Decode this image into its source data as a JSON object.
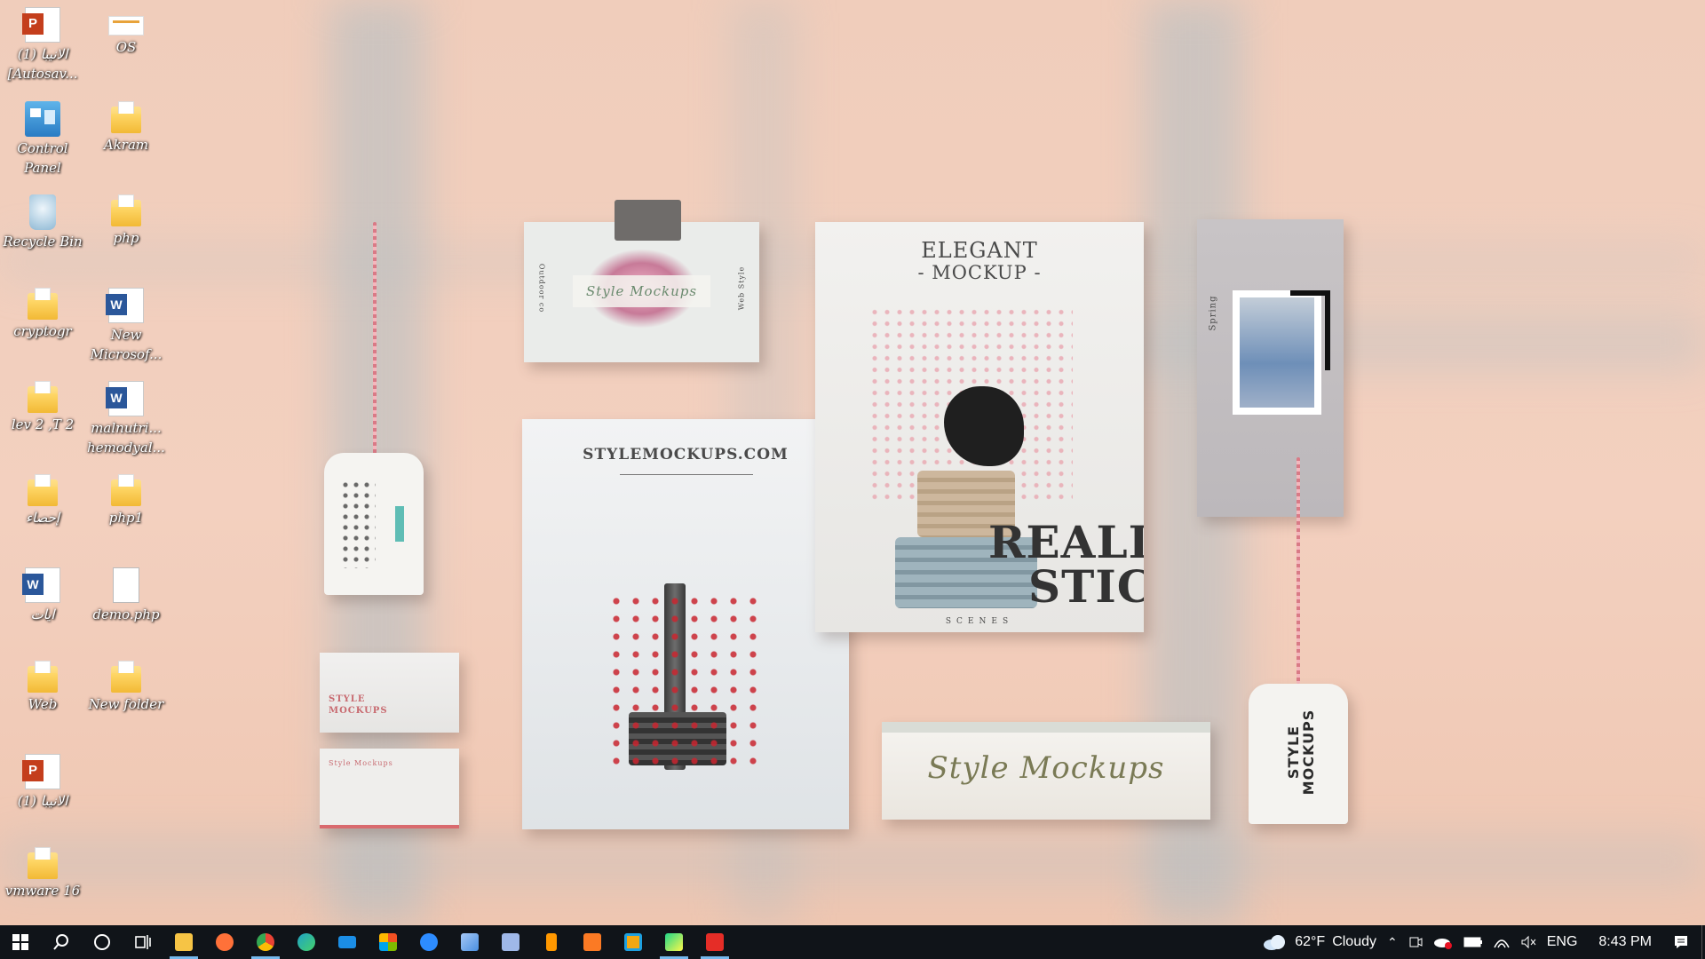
{
  "desktop": {
    "icons": [
      {
        "label": "(1) الانيبا [Autosav...",
        "icon": "powerpoint-icon"
      },
      {
        "label": "OS",
        "icon": "document-icon"
      },
      {
        "label": "Control Panel",
        "icon": "control-panel-icon"
      },
      {
        "label": "Akram",
        "icon": "folder-icon"
      },
      {
        "label": "Recycle Bin",
        "icon": "recycle-bin-icon"
      },
      {
        "label": "php",
        "icon": "folder-icon"
      },
      {
        "label": "cryptogr",
        "icon": "folder-icon"
      },
      {
        "label": "New Microsof...",
        "icon": "word-icon"
      },
      {
        "label": "lev 2 ,T 2",
        "icon": "folder-icon"
      },
      {
        "label": "malnutri... hemodyal...",
        "icon": "word-icon"
      },
      {
        "label": "إحصاء",
        "icon": "folder-icon"
      },
      {
        "label": "php1",
        "icon": "folder-icon"
      },
      {
        "label": "ايات",
        "icon": "word-icon"
      },
      {
        "label": "demo.php",
        "icon": "file-icon"
      },
      {
        "label": "Web",
        "icon": "folder-icon"
      },
      {
        "label": "New folder",
        "icon": "folder-icon"
      },
      {
        "label": "(1) الانيبا",
        "icon": "powerpoint-icon"
      },
      {
        "label": "vmware 16",
        "icon": "folder-icon"
      }
    ]
  },
  "wallpaper": {
    "elegant_title": "ELEGANT",
    "elegant_sub": "- MOCKUP -",
    "realistic_line1": "REALI",
    "realistic_line2": "STIC",
    "scenes": "SCENES",
    "site": "STYLEMOCKUPS.COM",
    "card_script": "Style Mockups",
    "banner_script": "Style Mockups",
    "bizcard_title": "STYLE MOCKUPS",
    "bizcard2_title": "Style Mockups",
    "tag_text": "STYLE MOCKUPS",
    "photo_caption": "Spring",
    "card_side_left": "Outdoor co",
    "card_side_right": "Web Style"
  },
  "taskbar": {
    "apps": [
      {
        "name": "start-button",
        "icon": "windows-logo-icon"
      },
      {
        "name": "search-button",
        "icon": "search-icon"
      },
      {
        "name": "cortana-button",
        "icon": "cortana-circle-icon"
      },
      {
        "name": "task-view-button",
        "icon": "task-view-icon"
      },
      {
        "name": "file-explorer",
        "icon": "file-explorer-icon",
        "color": "#f6c445"
      },
      {
        "name": "firefox",
        "icon": "firefox-icon",
        "color": "#ff7139"
      },
      {
        "name": "chrome",
        "icon": "chrome-icon",
        "color": "#4285f4"
      },
      {
        "name": "edge",
        "icon": "edge-icon",
        "color": "#1fa3c7"
      },
      {
        "name": "mail",
        "icon": "mail-icon",
        "color": "#1b8ee6"
      },
      {
        "name": "microsoft-store",
        "icon": "store-icon",
        "color": "#f3f3f3"
      },
      {
        "name": "zoom",
        "icon": "zoom-icon",
        "color": "#2d8cff"
      },
      {
        "name": "app-blue-arrow",
        "icon": "arrow-app-icon",
        "color": "#4a8fe0"
      },
      {
        "name": "virtualbox",
        "icon": "cube-icon",
        "color": "#9fb8e8"
      },
      {
        "name": "sublime-text",
        "icon": "sublime-icon",
        "color": "#ff9800"
      },
      {
        "name": "xampp",
        "icon": "xampp-icon",
        "color": "#fb7a24"
      },
      {
        "name": "app-orange-square",
        "icon": "square-app-icon",
        "color": "#1ea0e0"
      },
      {
        "name": "pycharm",
        "icon": "pycharm-icon",
        "color": "#21d789"
      },
      {
        "name": "acrobat",
        "icon": "pdf-icon",
        "color": "#e52d27"
      }
    ],
    "weather_temp": "62°F",
    "weather_desc": "Cloudy",
    "lang": "ENG",
    "time": "8:43 PM"
  }
}
